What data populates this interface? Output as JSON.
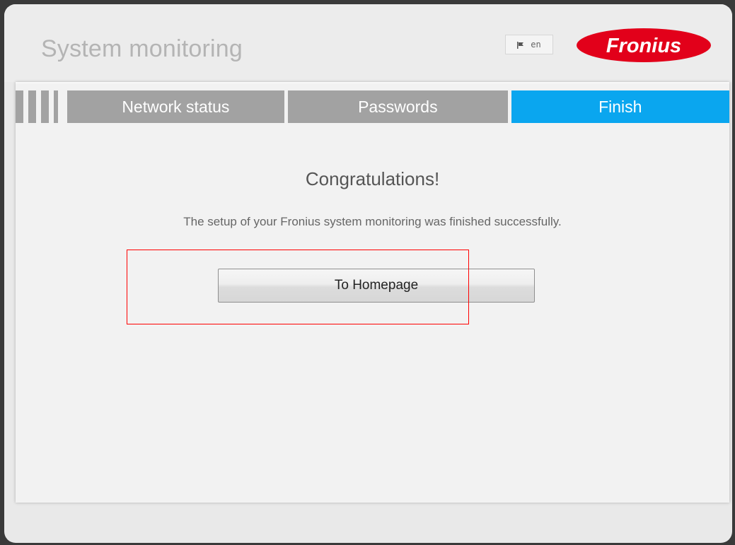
{
  "header": {
    "title": "System monitoring",
    "language": {
      "code": "en",
      "icon": "flag-icon"
    },
    "logo": {
      "text": "Fronius",
      "color": "#e2001a"
    }
  },
  "steps": [
    {
      "label": "Network status",
      "state": "inactive"
    },
    {
      "label": "Passwords",
      "state": "inactive"
    },
    {
      "label": "Finish",
      "state": "active"
    }
  ],
  "content": {
    "heading": "Congratulations!",
    "message": "The setup of your Fronius system monitoring was finished successfully.",
    "button_label": "To Homepage"
  },
  "colors": {
    "active_step": "#0aa6ef",
    "inactive_step": "#a2a2a2",
    "highlight": "#ff0000"
  }
}
